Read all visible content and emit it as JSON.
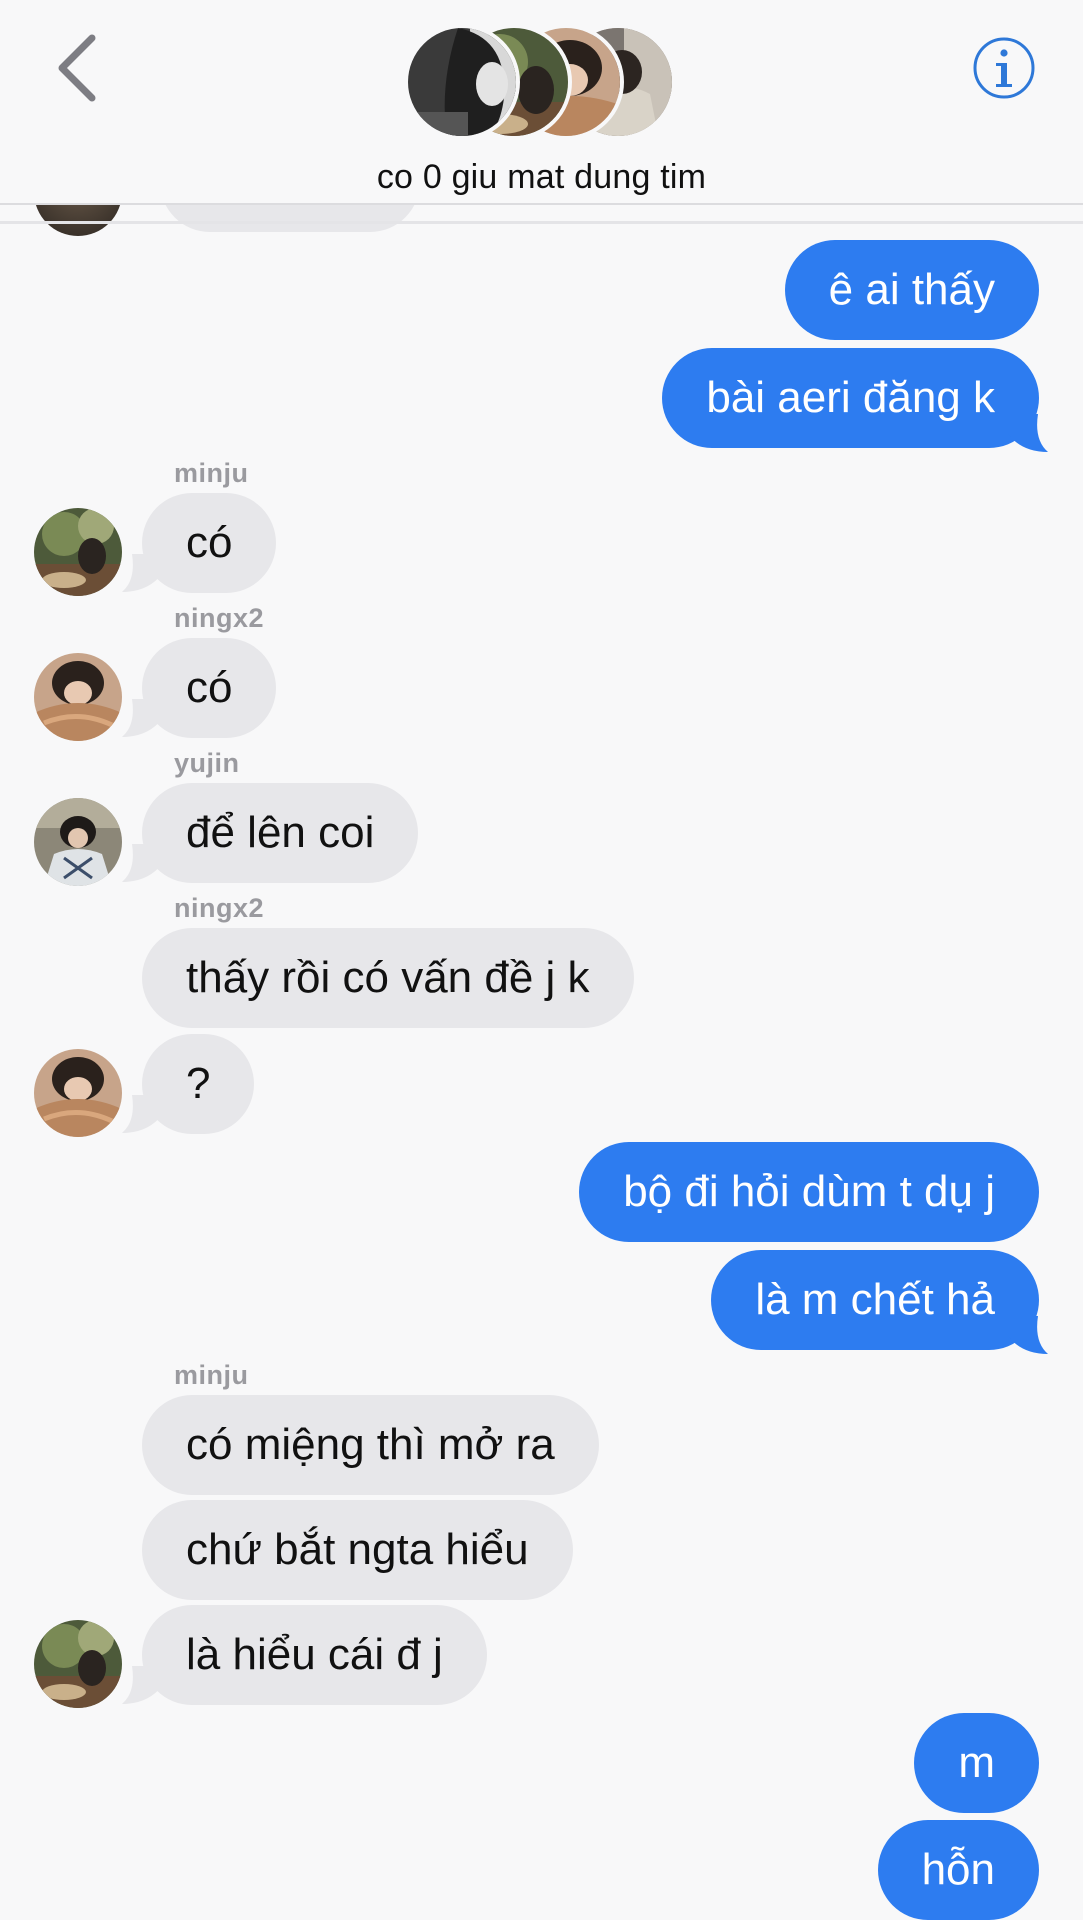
{
  "header": {
    "title": "co 0 giu mat dung tim",
    "colors": {
      "accent": "#2d7cf0",
      "info_icon": "#2e78d8",
      "back_icon": "#7d7d83"
    },
    "icons": {
      "back": "chevron-left-icon",
      "info": "info-circle-icon"
    }
  },
  "senders": {
    "s1": "minju",
    "s2": "ningx2",
    "s3": "yujin",
    "s4": "ningx2",
    "s5": "minju"
  },
  "messages": {
    "m1": "ê ai thấy",
    "m2": "bài aeri đăng k",
    "m3": "có",
    "m4": "có",
    "m5": "để lên coi",
    "m6": "thấy rồi có vấn đề j k",
    "m7": "?",
    "m8": "bộ đi hỏi dùm t dụ j",
    "m9": "là m chết hả",
    "m10": "có miệng thì mở ra",
    "m11": "chứ bắt ngta hiểu",
    "m12": "là hiểu cái đ j",
    "m13": "m",
    "m14": "hỗn"
  }
}
